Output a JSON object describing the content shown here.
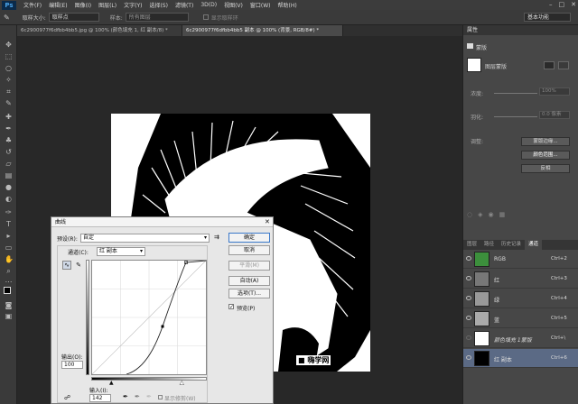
{
  "app": {
    "logo": "Ps"
  },
  "menu": [
    "文件(F)",
    "编辑(E)",
    "图像(I)",
    "图层(L)",
    "文字(Y)",
    "选择(S)",
    "滤镜(T)",
    "3D(D)",
    "视图(V)",
    "窗口(W)",
    "帮助(H)"
  ],
  "options_bar": {
    "sample_size_label": "取样大小:",
    "sample_size_value": "取样点",
    "sample_label": "样本:",
    "sample_value": "所有图层",
    "show_ring": "显示取样环",
    "workspace": "基本功能"
  },
  "tabs": [
    {
      "label": "6c2900977f6dfbb4bb5.jpg @ 100% (颜色填充 1, 红 副本/8) *",
      "active": false
    },
    {
      "label": "6c2900977f6dfbb4bb5 副本 @ 100% (背景, RGB/8#) *",
      "active": true
    }
  ],
  "canvas_watermark": "■ 嗨学网",
  "properties": {
    "tab": "属性",
    "subtitle": "蒙版",
    "mask_label": "图层蒙版",
    "density_label": "浓度:",
    "density_value": "100%",
    "feather_label": "羽化:",
    "feather_value": "0.0 像素",
    "adjust_label": "调整:",
    "btn_mask_edge": "蒙版边缘...",
    "btn_color_range": "颜色范围...",
    "btn_invert": "反相"
  },
  "channels_tabs": [
    "图层",
    "路径",
    "历史记录",
    "通道"
  ],
  "channels": [
    {
      "name": "RGB",
      "shortcut": "Ctrl+2",
      "selected": false
    },
    {
      "name": "红",
      "shortcut": "Ctrl+3",
      "selected": false
    },
    {
      "name": "绿",
      "shortcut": "Ctrl+4",
      "selected": false
    },
    {
      "name": "蓝",
      "shortcut": "Ctrl+5",
      "selected": false
    },
    {
      "name": "颜色填充 1蒙版",
      "shortcut": "Ctrl+\\",
      "selected": false
    },
    {
      "name": "红 副本",
      "shortcut": "Ctrl+6",
      "selected": true
    }
  ],
  "curves": {
    "title": "曲线",
    "preset_label": "预设(R):",
    "preset_value": "自定",
    "channel_label": "通道(C):",
    "channel_value": "红 副本",
    "output_label": "输出(O):",
    "output_value": "100",
    "input_label": "输入(I):",
    "input_value": "142",
    "show_clipping": "显示修剪(W)",
    "preview_label": "预览(P)",
    "buttons": {
      "ok": "确定",
      "cancel": "取消",
      "smooth": "平滑(M)",
      "auto": "自动(A)",
      "options": "选项(T)..."
    }
  }
}
